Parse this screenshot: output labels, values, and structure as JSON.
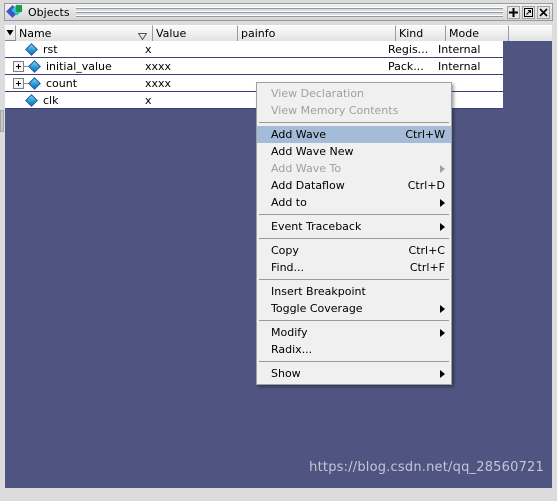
{
  "window": {
    "title": "Objects",
    "icon": "objects-icon",
    "buttons": [
      {
        "name": "maximize-pane-button",
        "glyph": "+"
      },
      {
        "name": "undock-pane-button",
        "glyph": "undock"
      },
      {
        "name": "close-pane-button",
        "glyph": "close"
      }
    ]
  },
  "table": {
    "columns": [
      {
        "label": "Name",
        "width": 137,
        "sorted": true
      },
      {
        "label": "Value",
        "width": 85,
        "sorted": false
      },
      {
        "label": "painfo",
        "width": 158,
        "sorted": false
      },
      {
        "label": "Kind",
        "width": 50,
        "sorted": false
      },
      {
        "label": "Mode",
        "width": 63,
        "sorted": false
      },
      {
        "label": "",
        "width": 43,
        "sorted": false
      }
    ],
    "rows": [
      {
        "name": "rst",
        "value": "x",
        "painfo": "",
        "kind": "Regis...",
        "mode": "Internal",
        "expandable": false
      },
      {
        "name": "initial_value",
        "value": "xxxx",
        "painfo": "",
        "kind": "Pack...",
        "mode": "Internal",
        "expandable": true
      },
      {
        "name": "count",
        "value": "xxxx",
        "painfo": "",
        "kind": "",
        "mode": "",
        "expandable": true
      },
      {
        "name": "clk",
        "value": "x",
        "painfo": "",
        "kind": "",
        "mode": "",
        "expandable": false
      }
    ]
  },
  "context_menu": {
    "items": [
      {
        "label": "View Declaration",
        "accel": "",
        "disabled": true,
        "submenu": false,
        "highlight": false
      },
      {
        "label": "View Memory Contents",
        "accel": "",
        "disabled": true,
        "submenu": false,
        "highlight": false
      },
      {
        "separator": true
      },
      {
        "label": "Add Wave",
        "accel": "Ctrl+W",
        "disabled": false,
        "submenu": false,
        "highlight": true
      },
      {
        "label": "Add Wave New",
        "accel": "",
        "disabled": false,
        "submenu": false,
        "highlight": false
      },
      {
        "label": "Add Wave To",
        "accel": "",
        "disabled": true,
        "submenu": true,
        "highlight": false
      },
      {
        "label": "Add Dataflow",
        "accel": "Ctrl+D",
        "disabled": false,
        "submenu": false,
        "highlight": false
      },
      {
        "label": "Add to",
        "accel": "",
        "disabled": false,
        "submenu": true,
        "highlight": false
      },
      {
        "separator": true
      },
      {
        "label": "Event Traceback",
        "accel": "",
        "disabled": false,
        "submenu": true,
        "highlight": false
      },
      {
        "separator": true
      },
      {
        "label": "Copy",
        "accel": "Ctrl+C",
        "disabled": false,
        "submenu": false,
        "highlight": false
      },
      {
        "label": "Find...",
        "accel": "Ctrl+F",
        "disabled": false,
        "submenu": false,
        "highlight": false
      },
      {
        "separator": true
      },
      {
        "label": "Insert Breakpoint",
        "accel": "",
        "disabled": false,
        "submenu": false,
        "highlight": false
      },
      {
        "label": "Toggle Coverage",
        "accel": "",
        "disabled": false,
        "submenu": true,
        "highlight": false
      },
      {
        "separator": true
      },
      {
        "label": "Modify",
        "accel": "",
        "disabled": false,
        "submenu": true,
        "highlight": false
      },
      {
        "label": "Radix...",
        "accel": "",
        "disabled": false,
        "submenu": false,
        "highlight": false
      },
      {
        "separator": true
      },
      {
        "label": "Show",
        "accel": "",
        "disabled": false,
        "submenu": true,
        "highlight": false
      }
    ]
  },
  "watermark": {
    "text": "https://blog.csdn.net/qq_28560721"
  },
  "colors": {
    "list_background": "#4f5580",
    "title_bar": "#ebebeb",
    "menu_background": "#f0f0f0",
    "menu_highlight": "#a5bcd9",
    "frame": "#dcdcdc"
  }
}
